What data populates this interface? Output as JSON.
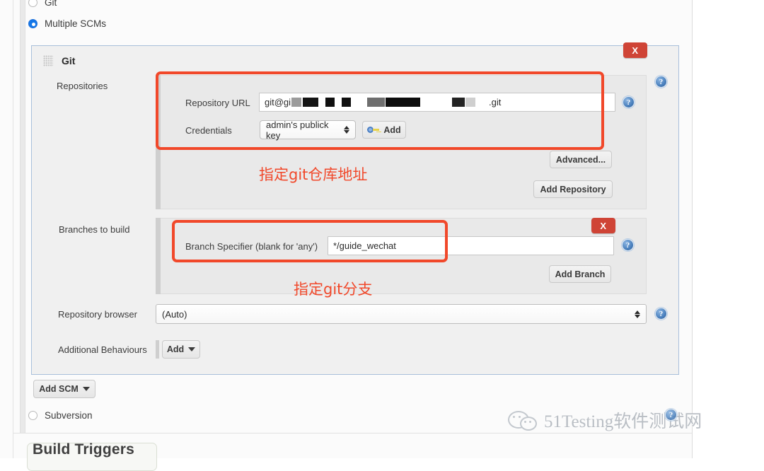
{
  "scm_choice": {
    "options": [
      {
        "label": "Git",
        "selected": false
      },
      {
        "label": "Multiple SCMs",
        "selected": true
      },
      {
        "label": "Subversion",
        "selected": false
      }
    ]
  },
  "scm_panel": {
    "title": "Git",
    "close_label": "X",
    "drag_handle_icon": "drag-grip-icon",
    "repositories": {
      "label": "Repositories",
      "repository_url": {
        "label": "Repository URL",
        "value_prefix": "git@gi",
        "value_suffix": ".git",
        "redacted": true,
        "help_icon": "help-icon"
      },
      "credentials": {
        "label": "Credentials",
        "selected": "admin's publick key",
        "add_button": {
          "label": "Add",
          "icon": "key-icon"
        }
      },
      "advanced_button": "Advanced...",
      "add_repository_button": "Add Repository",
      "help_icon": "help-icon"
    },
    "branches": {
      "label": "Branches to build",
      "close_label": "X",
      "branch_specifier": {
        "label": "Branch Specifier (blank for 'any')",
        "value": "*/guide_wechat",
        "help_icon": "help-icon"
      },
      "add_branch_button": "Add Branch",
      "help_icon": "help-icon"
    },
    "repository_browser": {
      "label": "Repository browser",
      "selected": "(Auto)",
      "help_icon": "help-icon"
    },
    "additional_behaviours": {
      "label": "Additional Behaviours",
      "add_button": "Add"
    }
  },
  "add_scm_button": "Add SCM",
  "build_triggers": {
    "title": "Build Triggers"
  },
  "annotations": [
    {
      "text": "指定git仓库地址"
    },
    {
      "text": "指定git分支"
    }
  ],
  "watermark": {
    "text": "51Testing软件测试网",
    "logo_icon": "wechat-logo-icon"
  },
  "colors": {
    "annotation": "#f1482a",
    "close_button": "#cf4436",
    "radio_selected": "#1477e8",
    "panel_border": "#a9c0db"
  }
}
